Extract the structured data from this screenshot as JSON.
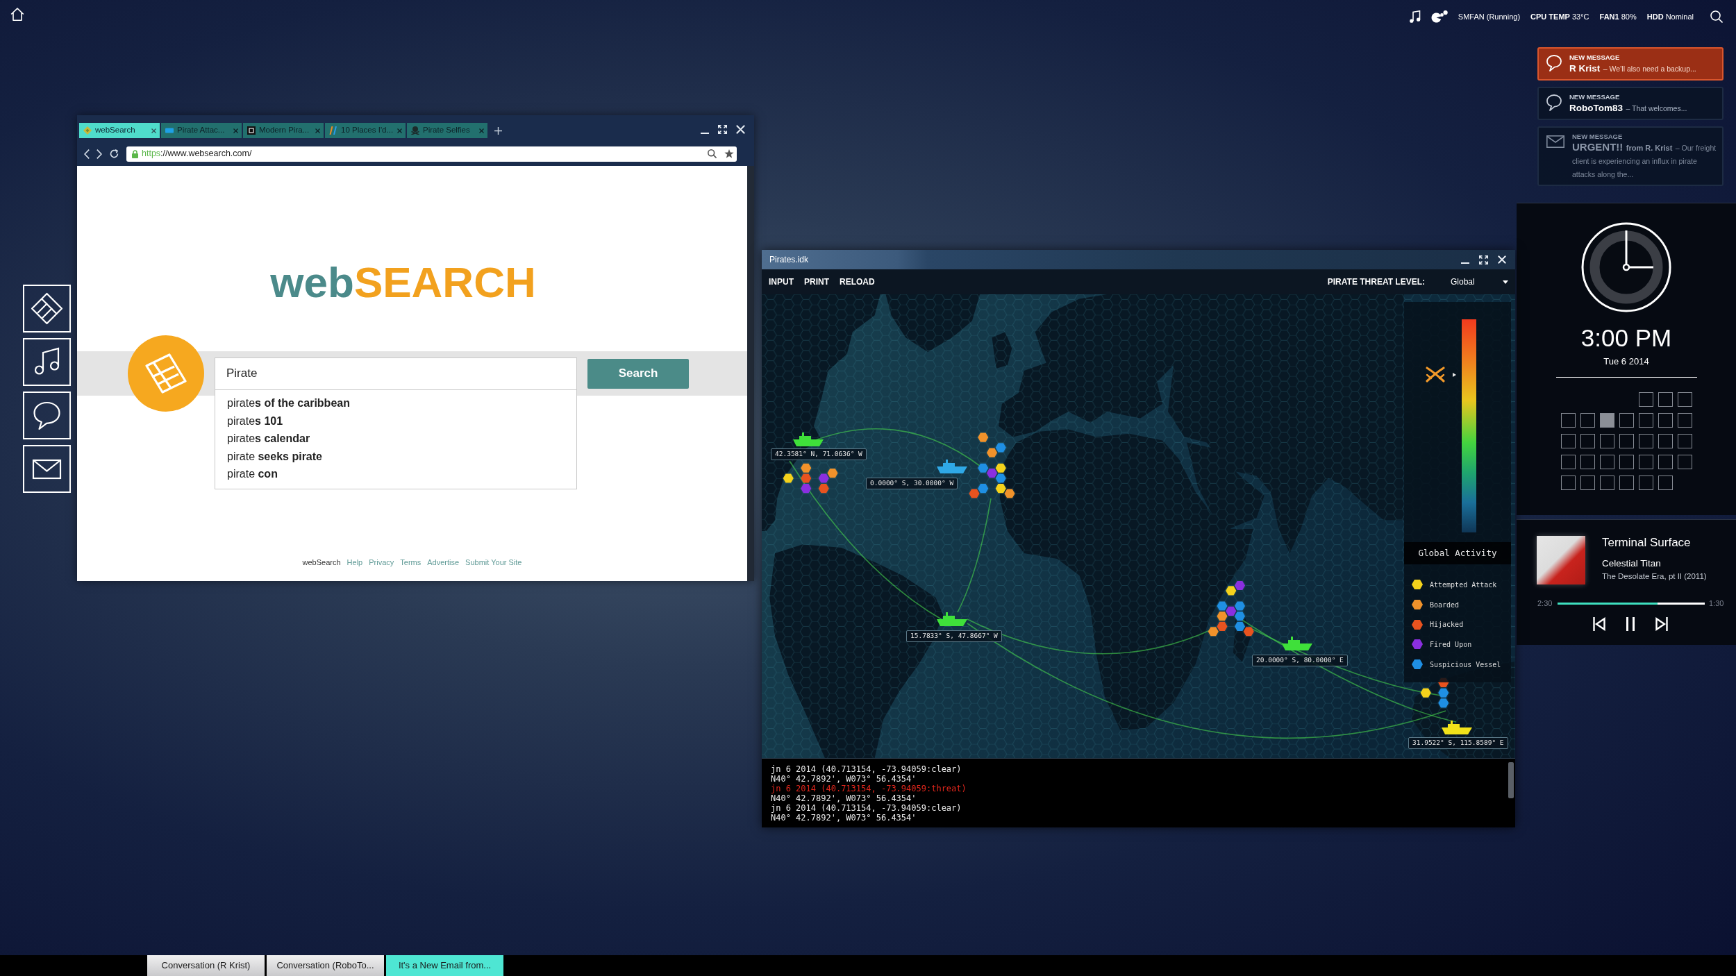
{
  "top_bar": {
    "status_items": [
      "SMFAN (Running)",
      "**CPU TEMP** 33°C",
      "**FAN1** 80%",
      "**HDD** Nominal"
    ]
  },
  "notifications": [
    {
      "kind": "chat",
      "active": true,
      "dimmed": false,
      "heading": "NEW MESSAGE",
      "sender": "R Krist",
      "preview": "– We’ll also need a backup..."
    },
    {
      "kind": "chat",
      "active": false,
      "dimmed": false,
      "heading": "NEW MESSAGE",
      "sender": "RoboTom83",
      "preview": "– That welcomes..."
    },
    {
      "kind": "email",
      "active": false,
      "dimmed": true,
      "heading": "NEW MESSAGE",
      "subject": "URGENT!!",
      "sender": "from R. Krist",
      "preview": "– Our freight client is experiencing an influx in pirate attacks along the..."
    }
  ],
  "browser": {
    "tabs": [
      {
        "label": "webSearch",
        "selected": true
      },
      {
        "label": "Pirate Attac...",
        "selected": false
      },
      {
        "label": "Modern Pira...",
        "selected": false
      },
      {
        "label": "10 Places I'd...",
        "selected": false
      },
      {
        "label": "Pirate Selfies",
        "selected": false
      }
    ],
    "address": {
      "scheme": "https",
      "rest": "://www.websearch.com/"
    },
    "page": {
      "logo": [
        "web",
        "SEARCH"
      ],
      "search_field": {
        "value": "Pirate"
      },
      "suggestions": [
        "pirate**s of the caribbean**",
        "pirate**s 101**",
        "pirate**s calendar**",
        "pirate **seeks pirate**",
        "pirate **con**"
      ],
      "search_button": "Search",
      "footer": {
        "brand": "webSearch",
        "links": [
          "Help",
          "Privacy",
          "Terms",
          "Advertise",
          "Submit Your Site"
        ]
      }
    }
  },
  "pirates_window": {
    "title": "Pirates.idk",
    "menu": [
      "INPUT",
      "PRINT",
      "RELOAD"
    ],
    "threat_level": {
      "label": "PIRATE THREAT LEVEL:",
      "value": "Global"
    },
    "map": {
      "ships": [
        {
          "coordinates": "42.3581° N, 71.0636° W",
          "color": "#3fe03a"
        },
        {
          "coordinates": "0.0000° S, 30.0000° W",
          "color": "#2fa8e6"
        },
        {
          "coordinates": "15.7833° S, 47.8667° W",
          "color": "#3fe03a"
        },
        {
          "coordinates": "20.0000° S, 80.0000° E",
          "color": "#3fe03a"
        },
        {
          "coordinates": "31.9522° S, 115.8589° E",
          "color": "#f2e21a"
        }
      ],
      "incidents": [
        {
          "color": "#f4d21c"
        },
        {
          "color": "#f0922b"
        },
        {
          "color": "#e8531f"
        },
        {
          "color": "#8a2fe0"
        },
        {
          "color": "#8a2fe0"
        },
        {
          "color": "#f0922b"
        },
        {
          "color": "#e8531f"
        },
        {
          "color": "#f0922b"
        },
        {
          "color": "#1f8fe3"
        },
        {
          "color": "#f0922b"
        },
        {
          "color": "#1f8fe3"
        },
        {
          "color": "#f4d21c"
        },
        {
          "color": "#8a2fe0"
        },
        {
          "color": "#1f8fe3"
        },
        {
          "color": "#1f8fe3"
        },
        {
          "color": "#e8531f"
        },
        {
          "color": "#f4d21c"
        },
        {
          "color": "#f0922b"
        },
        {
          "color": "#8a2fe0"
        },
        {
          "color": "#f4d21c"
        },
        {
          "color": "#1f8fe3"
        },
        {
          "color": "#8a2fe0"
        },
        {
          "color": "#1f8fe3"
        },
        {
          "color": "#f0922b"
        },
        {
          "color": "#1f8fe3"
        },
        {
          "color": "#e8531f"
        },
        {
          "color": "#1f8fe3"
        },
        {
          "color": "#f0922b"
        },
        {
          "color": "#e8531f"
        },
        {
          "color": "#e8531f"
        },
        {
          "color": "#f4d21c"
        },
        {
          "color": "#1f8fe3"
        },
        {
          "color": "#1f8fe3"
        }
      ]
    },
    "legend": {
      "threat_meter": {
        "level": 0.74
      },
      "title": "Global Activity",
      "items": [
        {
          "label": "Attempted Attack",
          "color": "#f4d21c"
        },
        {
          "label": "Boarded",
          "color": "#f0922b"
        },
        {
          "label": "Hijacked",
          "color": "#e8531f"
        },
        {
          "label": "Fired Upon",
          "color": "#8a2fe0"
        },
        {
          "label": "Suspicious Vessel",
          "color": "#1f8fe3"
        }
      ]
    },
    "console": [
      {
        "text": "jn 6 2014 (40.713154, -73.94059:clear)",
        "alert": false
      },
      {
        "text": "N40° 42.7892', W073° 56.4354'",
        "alert": false
      },
      {
        "text": "jn 6 2014 (40.713154, -73.94059:threat)",
        "alert": true
      },
      {
        "text": "N40° 42.7892', W073° 56.4354'",
        "alert": false
      },
      {
        "text": "jn 6 2014 (40.713154, -73.94059:clear)",
        "alert": false
      },
      {
        "text": "N40° 42.7892', W073° 56.4354'",
        "alert": false
      }
    ]
  },
  "clock_panel": {
    "time": "3:00 PM",
    "date": "Tue 6 2014",
    "calendar": {
      "weeks": [
        {
          "days": [
            {
              "selected": false
            },
            {
              "selected": false
            },
            {
              "selected": false
            }
          ]
        },
        {
          "days": [
            {
              "selected": false
            },
            {
              "selected": false
            },
            {
              "selected": true
            },
            {
              "selected": false
            },
            {
              "selected": false
            },
            {
              "selected": false
            },
            {
              "selected": false
            }
          ]
        },
        {
          "days": [
            {
              "selected": false
            },
            {
              "selected": false
            },
            {
              "selected": false
            },
            {
              "selected": false
            },
            {
              "selected": false
            },
            {
              "selected": false
            },
            {
              "selected": false
            }
          ]
        },
        {
          "days": [
            {
              "selected": false
            },
            {
              "selected": false
            },
            {
              "selected": false
            },
            {
              "selected": false
            },
            {
              "selected": false
            },
            {
              "selected": false
            },
            {
              "selected": false
            }
          ]
        },
        {
          "days": [
            {
              "selected": false
            },
            {
              "selected": false
            },
            {
              "selected": false
            },
            {
              "selected": false
            },
            {
              "selected": false
            },
            {
              "selected": false
            }
          ]
        }
      ]
    }
  },
  "player": {
    "title": "Terminal Surface",
    "artist": "Celestial Titan",
    "album": "The Desolate Era, pt II (2011)",
    "elapsed": "2:30",
    "remaining": "1:30",
    "level": 0.68,
    "playing": true
  },
  "taskbar": [
    {
      "label": "Conversation (R Krist)",
      "selected": false
    },
    {
      "label": "Conversation (RoboTo...",
      "selected": false
    },
    {
      "label": "It's a New Email from...",
      "selected": true
    }
  ]
}
